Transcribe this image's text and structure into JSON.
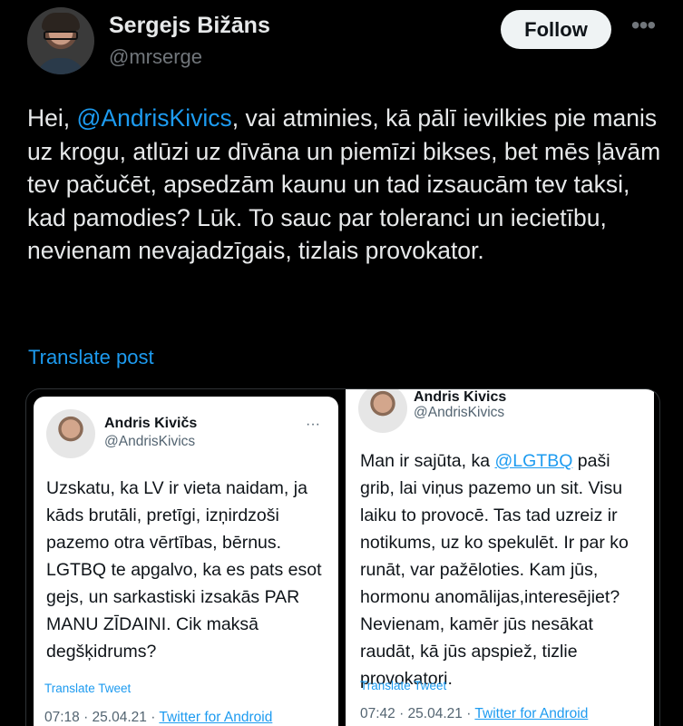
{
  "author": {
    "name": "Sergejs Bižāns",
    "handle": "@mrserge"
  },
  "actions": {
    "follow_label": "Follow",
    "more_icon": "•••"
  },
  "post": {
    "text_before": "Hei, ",
    "mention": "@AndrisKivics",
    "text_after": ", vai atminies, kā pālī ievilkies pie manis uz krogu, atlūzi uz dīvāna un piemīzi bikses, bet mēs ļāvām tev pačučēt, apsedzām kaunu un tad izsaucām tev taksi, kad pamodies? Lūk. To sauc par toleranci un iecietību, nevienam nevajadzīgais, tizlais provokator.",
    "translate_label": "Translate post"
  },
  "media": {
    "left": {
      "name": "Andris Kivičs",
      "handle": "@AndrisKivics",
      "more": "···",
      "text": "Uzskatu, ka LV ir vieta naidam, ja kāds brutāli, pretīgi, izņirdzoši pazemo otra vērtības, bērnus. LGTBQ te apgalvo, ka es pats esot gejs, un sarkastiski izsakās PAR MANU ZĪDAINI. Cik maksā degšķidrums?",
      "translate": "Translate Tweet",
      "time": "07:18 · 25.04.21 · ",
      "source": "Twitter for Android"
    },
    "right": {
      "name": "Andris Kivics",
      "handle": "@AndrisKivics",
      "text_before": "Man ir sajūta, ka ",
      "mention": "@LGTBQ",
      "text_after": " paši grib, lai viņus pazemo un sit. Visu laiku to provocē. Tas tad uzreiz ir notikums, uz ko spekulēt. Ir par ko runāt, var pažēloties. Kam jūs, hormonu anomālijas,interesējiet? Nevienam, kamēr jūs nesākat raudāt, kā jūs apspiež, tizlie provokatori.",
      "translate": "Translate Tweet",
      "time": "07:42 · 25.04.21 · ",
      "source": "Twitter for Android"
    }
  },
  "colors": {
    "background": "#000000",
    "accent": "#1d9bf0",
    "text": "#e7e9ea",
    "muted": "#71767b"
  }
}
